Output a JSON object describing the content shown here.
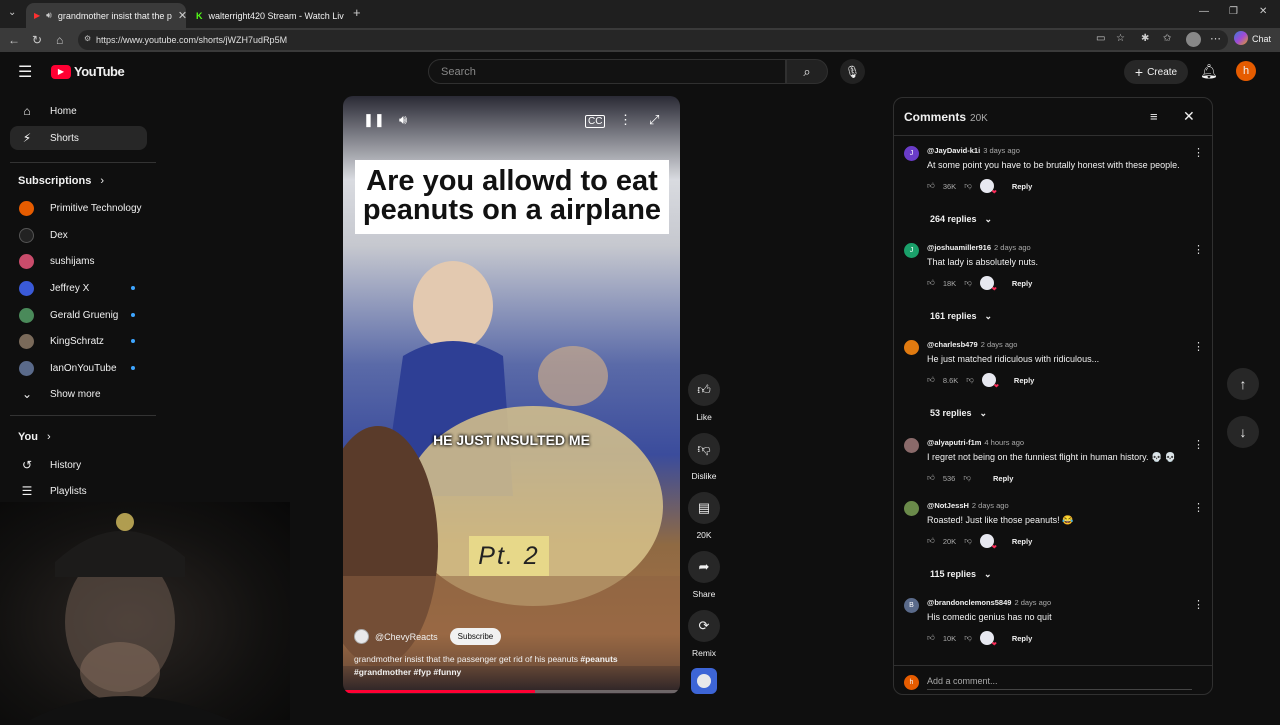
{
  "browser": {
    "tabs": [
      {
        "title": "grandmother insist that the p",
        "active": true
      },
      {
        "title": "walterright420 Stream - Watch Liv",
        "active": false
      }
    ],
    "url": "https://www.youtube.com/shorts/jWZH7udRp5M",
    "chat_label": "Chat"
  },
  "header": {
    "logo_text": "YouTube",
    "search_placeholder": "Search",
    "create_label": "Create",
    "avatar_letter": "h"
  },
  "sidebar": {
    "main": [
      {
        "label": "Home",
        "icon": "home-icon"
      },
      {
        "label": "Shorts",
        "icon": "shorts-icon",
        "selected": true
      }
    ],
    "subscriptions_title": "Subscriptions",
    "subscriptions": [
      {
        "label": "Primitive Technology",
        "color": "#e65c00",
        "dot": false
      },
      {
        "label": "Dex",
        "color": "#222222",
        "dot": false
      },
      {
        "label": "sushijams",
        "color": "#c94c6b",
        "dot": false
      },
      {
        "label": "Jeffrey X",
        "color": "#3a5ad8",
        "dot": true
      },
      {
        "label": "Gerald Gruenig",
        "color": "#4a8a5a",
        "dot": true
      },
      {
        "label": "KingSchratz",
        "color": "#7a6a5a",
        "dot": true
      },
      {
        "label": "IanOnYouTube",
        "color": "#5a6a8a",
        "dot": true
      }
    ],
    "show_more": "Show more",
    "you_title": "You",
    "you_items": [
      {
        "label": "History",
        "icon": "history-icon"
      },
      {
        "label": "Playlists",
        "icon": "playlists-icon"
      }
    ]
  },
  "video": {
    "title_overlay": "Are you allowd to eat peanuts on a airplane",
    "caption": "HE JUST INSULTED ME",
    "part_label": "Pt. 2",
    "channel": "@ChevyReacts",
    "subscribe_label": "Subscribe",
    "description": "grandmother insist that the passenger get rid of his peanuts",
    "hashtags": [
      "#peanuts",
      "#grandmother",
      "#fyp",
      "#funny"
    ],
    "progress": 0.57
  },
  "actions": [
    {
      "label": "Like",
      "icon": "thumbs-up-icon"
    },
    {
      "label": "Dislike",
      "icon": "thumbs-down-icon"
    },
    {
      "label": "20K",
      "icon": "comment-icon"
    },
    {
      "label": "Share",
      "icon": "share-icon"
    },
    {
      "label": "Remix",
      "icon": "remix-icon"
    }
  ],
  "comments": {
    "title": "Comments",
    "count": "20K",
    "items": [
      {
        "author": "@JayDavid-k1i",
        "time": "3 days ago",
        "text": "At some point you have to be brutally honest with these people.",
        "likes": "36K",
        "avatar_letter": "J",
        "avatar_color": "#6a3cc8",
        "replies": "264 replies"
      },
      {
        "author": "@joshuamiller916",
        "time": "2 days ago",
        "text": "That lady is absolutely nuts.",
        "likes": "18K",
        "avatar_letter": "J",
        "avatar_color": "#1aa06a",
        "replies": "161 replies"
      },
      {
        "author": "@charlesb479",
        "time": "2 days ago",
        "text": "He just matched ridiculous with ridiculous...",
        "likes": "8.6K",
        "avatar_letter": "",
        "avatar_color": "#e07a10",
        "replies": "53 replies"
      },
      {
        "author": "@alyaputri-f1m",
        "time": "4 hours ago",
        "text": "I regret not being on the funniest flight in human history. 💀 💀",
        "likes": "536",
        "avatar_letter": "",
        "avatar_color": "#8a6a6a",
        "replies": ""
      },
      {
        "author": "@NotJessH",
        "time": "2 days ago",
        "text": "Roasted! Just like those peanuts! 😂",
        "likes": "20K",
        "avatar_letter": "",
        "avatar_color": "#6a8a4a",
        "replies": "115 replies"
      },
      {
        "author": "@brandonclemons5849",
        "time": "2 days ago",
        "text": "His comedic genius has no quit",
        "likes": "10K",
        "avatar_letter": "B",
        "avatar_color": "#5a6a8a",
        "replies": ""
      }
    ],
    "reply_label": "Reply",
    "add_placeholder": "Add a comment...",
    "user_avatar_letter": "h"
  }
}
